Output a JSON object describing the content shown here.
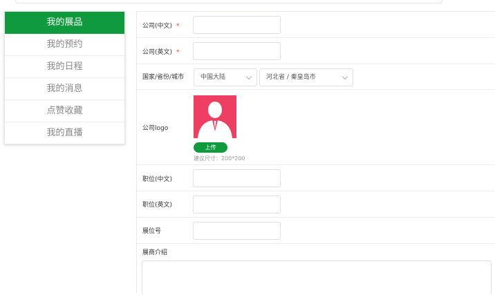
{
  "sidebar": {
    "items": [
      {
        "label": "我的展品",
        "active": true
      },
      {
        "label": "我的预约"
      },
      {
        "label": "我的日程"
      },
      {
        "label": "我的消息"
      },
      {
        "label": "点赞收藏"
      },
      {
        "label": "我的直播"
      }
    ]
  },
  "form": {
    "company_cn": {
      "label": "公司(中文)",
      "required_mark": "*",
      "value": ""
    },
    "company_en": {
      "label": "公司(英文)",
      "required_mark": "*",
      "value": ""
    },
    "location": {
      "label": "国家/省份/城市",
      "country": "中国大陆",
      "province_city": "河北省 / 秦皇岛市"
    },
    "logo": {
      "label": "公司logo",
      "upload_label": "上传",
      "hint": "建议尺寸：200*200"
    },
    "position_cn": {
      "label": "职位(中文)",
      "value": ""
    },
    "position_en": {
      "label": "职位(英文)",
      "value": ""
    },
    "booth": {
      "label": "展位号",
      "value": ""
    },
    "intro": {
      "label": "展商介绍",
      "value": ""
    }
  },
  "colors": {
    "accent": "#109a3e",
    "required": "#e0413a",
    "logo_bg": "#ee3f63"
  }
}
